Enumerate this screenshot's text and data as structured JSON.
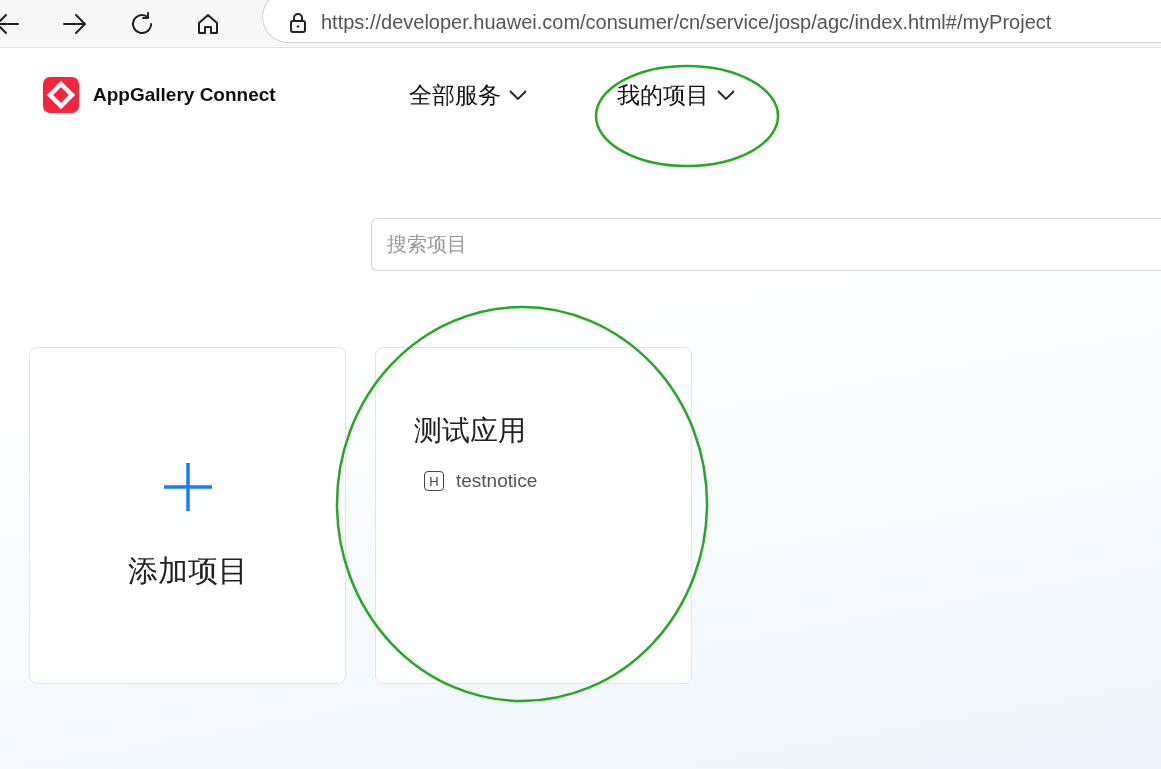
{
  "browser": {
    "url": "https://developer.huawei.com/consumer/cn/service/josp/agc/index.html#/myProject"
  },
  "header": {
    "logo_text": "AppGallery Connect",
    "nav": [
      {
        "label": "全部服务"
      },
      {
        "label": "我的项目"
      }
    ]
  },
  "search": {
    "placeholder": "搜索项目"
  },
  "cards": [
    {
      "kind": "add",
      "label": "添加项目"
    },
    {
      "kind": "project",
      "title": "测试应用",
      "apps": [
        {
          "badge": "H",
          "name": "testnotice"
        }
      ]
    }
  ]
}
